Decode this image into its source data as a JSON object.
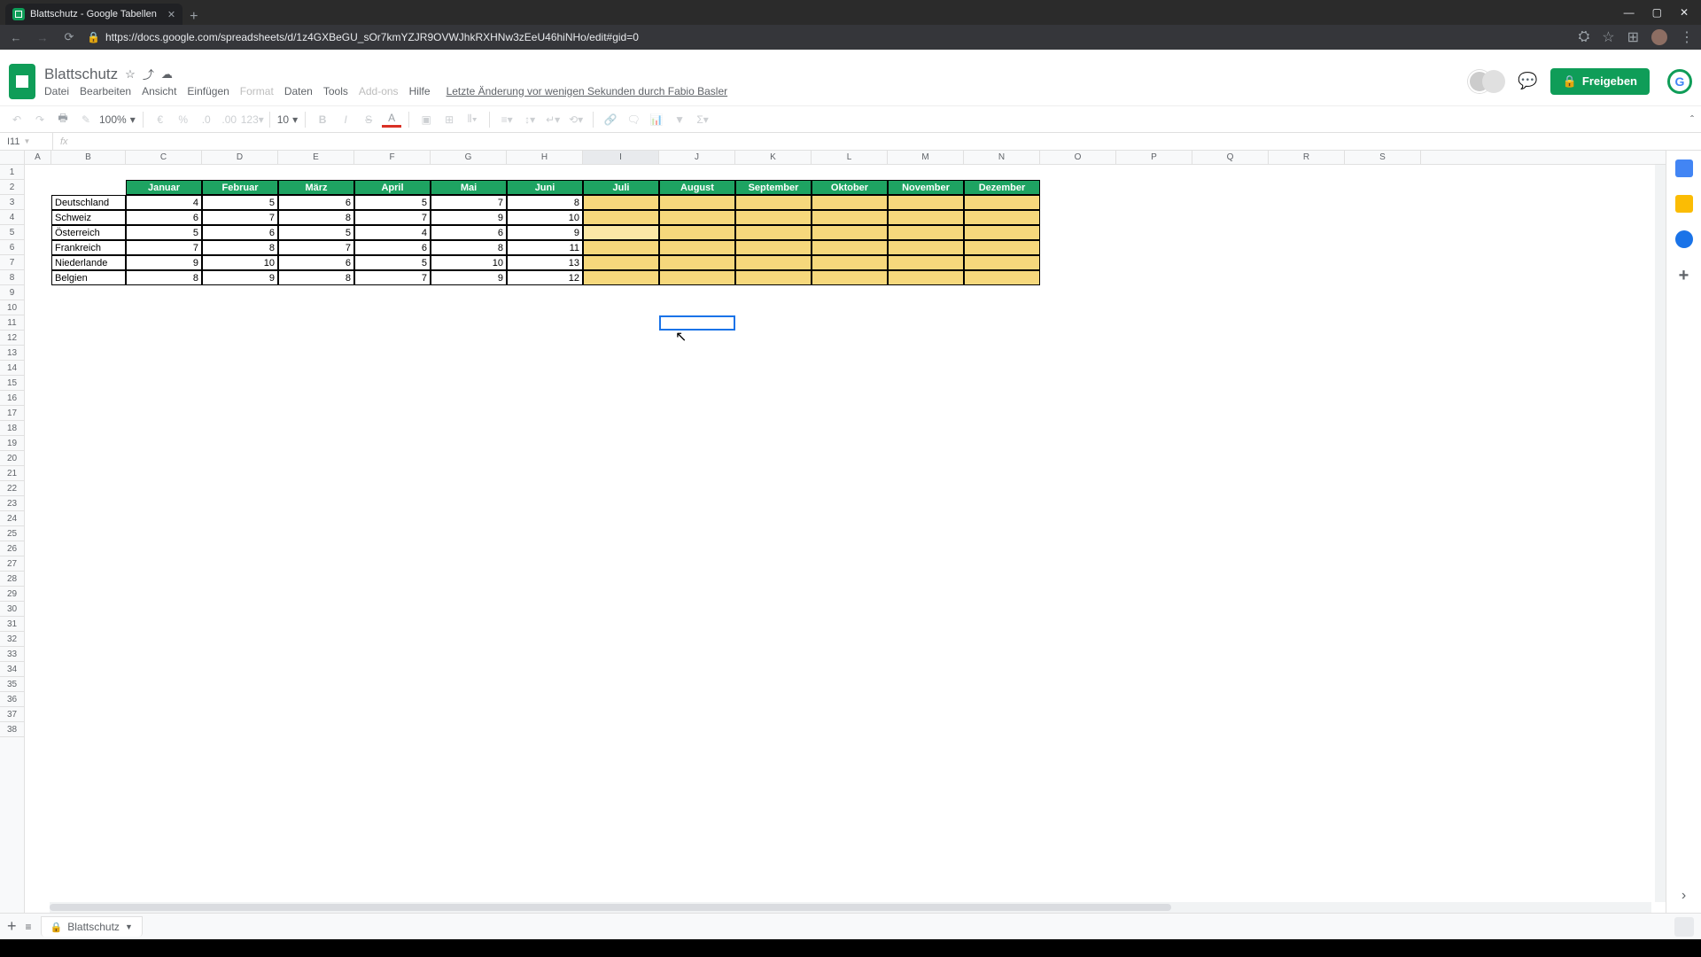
{
  "browser": {
    "tab_title": "Blattschutz - Google Tabellen",
    "url": "https://docs.google.com/spreadsheets/d/1z4GXBeGU_sOr7kmYZJR9OVWJhkRXHNw3zEeU46hiNHo/edit#gid=0"
  },
  "doc": {
    "title": "Blattschutz",
    "menus": [
      "Datei",
      "Bearbeiten",
      "Ansicht",
      "Einfügen",
      "Format",
      "Daten",
      "Tools",
      "Add-ons",
      "Hilfe"
    ],
    "last_edit": "Letzte Änderung vor wenigen Sekunden durch Fabio Basler",
    "share": "Freigeben"
  },
  "toolbar": {
    "zoom": "100%",
    "font_size": "10"
  },
  "formula": {
    "name_box": "I11",
    "fx": "fx"
  },
  "columns": [
    "A",
    "B",
    "C",
    "D",
    "E",
    "F",
    "G",
    "H",
    "I",
    "J",
    "K",
    "L",
    "M",
    "N",
    "O",
    "P",
    "Q",
    "R",
    "S"
  ],
  "selected_col": "I",
  "active_cell": "I11",
  "chart_data": {
    "type": "table",
    "months": [
      "Januar",
      "Februar",
      "März",
      "April",
      "Mai",
      "Juni",
      "Juli",
      "August",
      "September",
      "Oktober",
      "November",
      "Dezember"
    ],
    "countries": [
      "Deutschland",
      "Schweiz",
      "Österreich",
      "Frankreich",
      "Niederlande",
      "Belgien"
    ],
    "values": {
      "Deutschland": [
        4,
        5,
        6,
        5,
        7,
        8,
        null,
        null,
        null,
        null,
        null,
        null
      ],
      "Schweiz": [
        6,
        7,
        8,
        7,
        9,
        10,
        null,
        null,
        null,
        null,
        null,
        null
      ],
      "Österreich": [
        5,
        6,
        5,
        4,
        6,
        9,
        null,
        null,
        null,
        null,
        null,
        null
      ],
      "Frankreich": [
        7,
        8,
        7,
        6,
        8,
        11,
        null,
        null,
        null,
        null,
        null,
        null
      ],
      "Niederlande": [
        9,
        10,
        6,
        5,
        10,
        13,
        null,
        null,
        null,
        null,
        null,
        null
      ],
      "Belgien": [
        8,
        9,
        8,
        7,
        9,
        12,
        null,
        null,
        null,
        null,
        null,
        null
      ]
    }
  },
  "sheet_tab": "Blattschutz"
}
